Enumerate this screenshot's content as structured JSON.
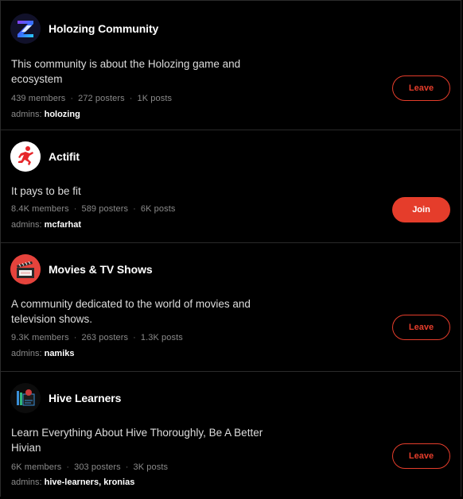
{
  "colors": {
    "accent": "#e53d2b",
    "background": "#000000",
    "muted": "#8a8a8a"
  },
  "communities": [
    {
      "name": "Holozing Community",
      "description": "This community is about the Holozing game and ecosystem",
      "members": "439 members",
      "posters": "272 posters",
      "posts": "1K posts",
      "admins_label": "admins:",
      "admins": "holozing",
      "action": "Leave",
      "icon": "holozing-logo-icon"
    },
    {
      "name": "Actifit",
      "description": "It pays to be fit",
      "members": "8.4K members",
      "posters": "589 posters",
      "posts": "6K posts",
      "admins_label": "admins:",
      "admins": "mcfarhat",
      "action": "Join",
      "icon": "runner-icon"
    },
    {
      "name": "Movies & TV Shows",
      "description": "A community dedicated to the world of movies and television shows.",
      "members": "9.3K members",
      "posters": "263 posters",
      "posts": "1.3K posts",
      "admins_label": "admins:",
      "admins": "namiks",
      "action": "Leave",
      "icon": "ticket-icon"
    },
    {
      "name": "Hive Learners",
      "description": "Learn Everything About Hive Thoroughly, Be A Better Hivian",
      "members": "6K members",
      "posters": "303 posters",
      "posts": "3K posts",
      "admins_label": "admins:",
      "admins": "hive-learners, kronias",
      "action": "Leave",
      "icon": "books-icon"
    }
  ]
}
